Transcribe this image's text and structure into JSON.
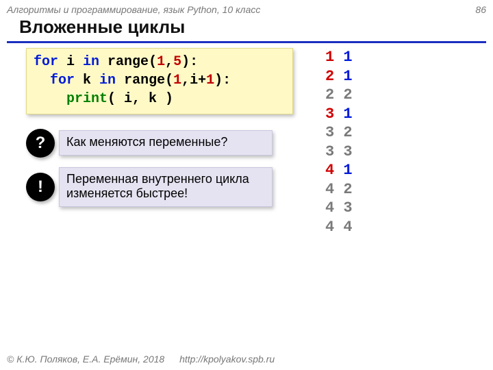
{
  "header": {
    "course": "Алгоритмы и программирование, язык Python, 10 класс",
    "page_number": "86"
  },
  "title": "Вложенные циклы",
  "code": {
    "l1_for": "for",
    "l1_var": " i ",
    "l1_in": "in",
    "l1_range": " range",
    "l1_open": "(",
    "l1_a": "1",
    "l1_comma": ",",
    "l1_b": "5",
    "l1_close": "):",
    "l2_pad": "  ",
    "l2_for": "for",
    "l2_var": " k ",
    "l2_in": "in",
    "l2_range": " range",
    "l2_open": "(",
    "l2_a": "1",
    "l2_comma": ",i+",
    "l2_b": "1",
    "l2_close": "):",
    "l3_pad": "    ",
    "l3_print": "print",
    "l3_args": "( i, k )"
  },
  "callouts": {
    "q_icon": "?",
    "q_text": "Как меняются переменные?",
    "e_icon": "!",
    "e_text": "Переменная внутреннего цикла изменяется быстрее!"
  },
  "output": [
    {
      "i": "1",
      "k": "1",
      "i_first": true,
      "k_first": true
    },
    {
      "i": "2",
      "k": "1",
      "i_first": true,
      "k_first": true
    },
    {
      "i": "2",
      "k": "2",
      "i_first": false,
      "k_first": false
    },
    {
      "i": "3",
      "k": "1",
      "i_first": true,
      "k_first": true
    },
    {
      "i": "3",
      "k": "2",
      "i_first": false,
      "k_first": false
    },
    {
      "i": "3",
      "k": "3",
      "i_first": false,
      "k_first": false
    },
    {
      "i": "4",
      "k": "1",
      "i_first": true,
      "k_first": true
    },
    {
      "i": "4",
      "k": "2",
      "i_first": false,
      "k_first": false
    },
    {
      "i": "4",
      "k": "3",
      "i_first": false,
      "k_first": false
    },
    {
      "i": "4",
      "k": "4",
      "i_first": false,
      "k_first": false
    }
  ],
  "footer": {
    "copyright": "© К.Ю. Поляков, Е.А. Ерёмин, 2018",
    "url": "http://kpolyakov.spb.ru"
  }
}
